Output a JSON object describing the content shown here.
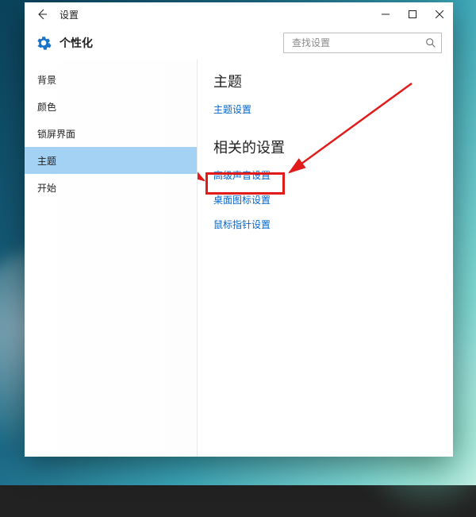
{
  "titlebar": {
    "title": "设置"
  },
  "header": {
    "title": "个性化",
    "search_placeholder": "查找设置"
  },
  "sidebar": {
    "items": [
      {
        "label": "背景"
      },
      {
        "label": "颜色"
      },
      {
        "label": "锁屏界面"
      },
      {
        "label": "主题"
      },
      {
        "label": "开始"
      }
    ],
    "selected_index": 3
  },
  "content": {
    "section1_title": "主题",
    "theme_settings_link": "主题设置",
    "section2_title": "相关的设置",
    "links": [
      "高级声音设置",
      "桌面图标设置",
      "鼠标指针设置"
    ]
  }
}
